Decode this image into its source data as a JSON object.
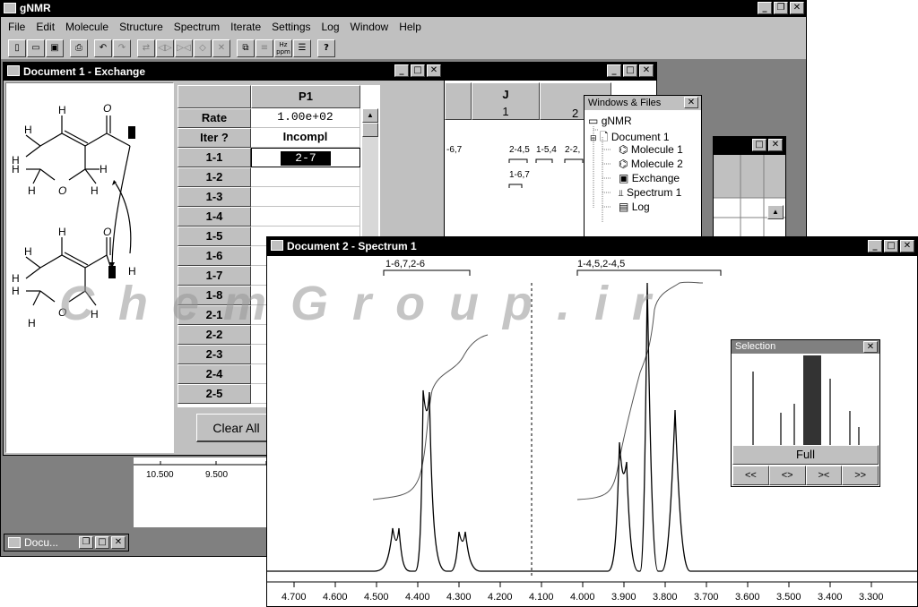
{
  "app": {
    "title": "gNMR"
  },
  "menu": [
    "File",
    "Edit",
    "Molecule",
    "Structure",
    "Spectrum",
    "Iterate",
    "Settings",
    "Log",
    "Window",
    "Help"
  ],
  "toolbar": {
    "hz_ppm_label": "Hz ppm",
    "help_label": "?"
  },
  "doc1": {
    "title": "Document 1 - Exchange",
    "column_header": "P1",
    "rows": [
      {
        "label": "Rate",
        "value": "1.00e+02"
      },
      {
        "label": "Iter ?",
        "value": "Incompl"
      },
      {
        "label": "1-1",
        "value": "2-7"
      },
      {
        "label": "1-2",
        "value": ""
      },
      {
        "label": "1-3",
        "value": ""
      },
      {
        "label": "1-4",
        "value": ""
      },
      {
        "label": "1-5",
        "value": ""
      },
      {
        "label": "1-6",
        "value": ""
      },
      {
        "label": "1-7",
        "value": ""
      },
      {
        "label": "1-8",
        "value": ""
      },
      {
        "label": "2-1",
        "value": ""
      },
      {
        "label": "2-2",
        "value": ""
      },
      {
        "label": "2-3",
        "value": ""
      },
      {
        "label": "2-4",
        "value": ""
      },
      {
        "label": "2-5",
        "value": ""
      }
    ],
    "clear_all_label": "Clear All",
    "atoms": {
      "H": "H",
      "O": "O"
    }
  },
  "back_spectrum": {
    "ticks": [
      "10.500",
      "9.500"
    ]
  },
  "j_window": {
    "header": "J",
    "col1": "1",
    "col2": "2",
    "labels": [
      "-6,7",
      "2-4,5",
      "1-5,4",
      "2-2,",
      "1-6,7"
    ]
  },
  "minimized": {
    "title": "Docu..."
  },
  "winfiles": {
    "title": "Windows & Files",
    "items": [
      "gNMR",
      "Document 1",
      "Molecule 1",
      "Molecule 2",
      "Exchange",
      "Spectrum 1",
      "Log"
    ]
  },
  "doc2": {
    "title": "Document 2 - Spectrum 1",
    "annotations": [
      "1-6,7,2-6",
      "1-4,5,2-4,5"
    ],
    "axis_ticks": [
      "4.700",
      "4.600",
      "4.500",
      "4.400",
      "4.300",
      "4.200",
      "4.100",
      "4.000",
      "3.900",
      "3.800",
      "3.700",
      "3.600",
      "3.500",
      "3.400",
      "3.300"
    ]
  },
  "selection": {
    "title": "Selection",
    "full_label": "Full",
    "nav": [
      "<<",
      "<>",
      "><",
      ">>"
    ]
  },
  "watermark": "C h e m G r o u p . i r"
}
